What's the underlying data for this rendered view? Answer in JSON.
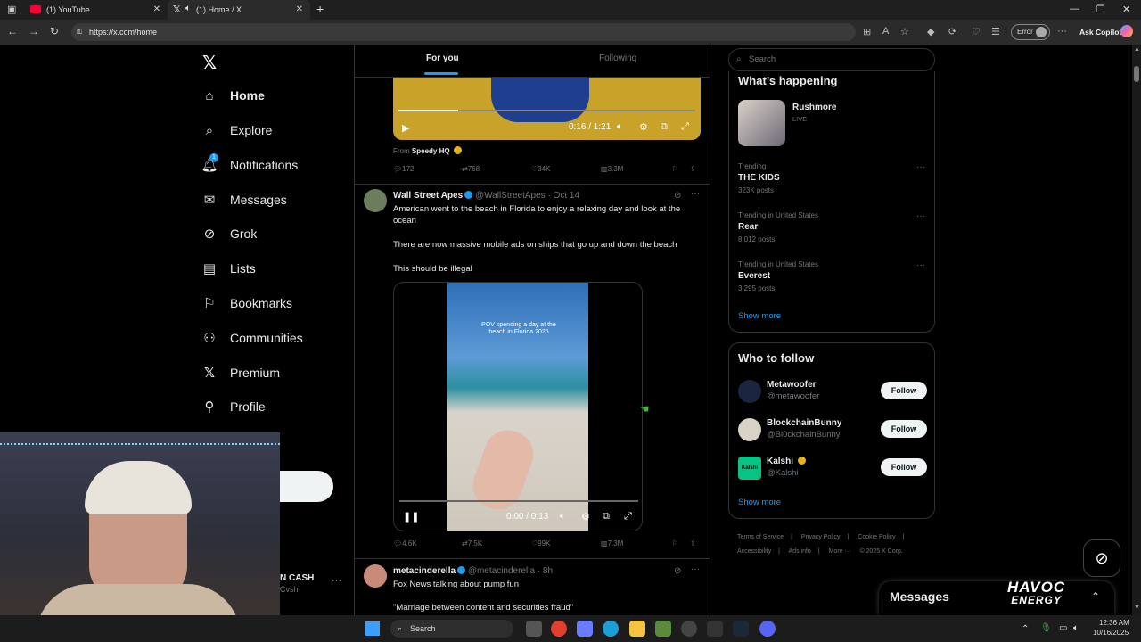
{
  "browser": {
    "tabs": [
      {
        "title": "(1) YouTube"
      },
      {
        "title": "(1) Home / X"
      }
    ],
    "url": "https://x.com/home",
    "error_label": "Error",
    "copilot_label": "Ask Copilot"
  },
  "nav": {
    "items": [
      {
        "label": "Home",
        "icon": "home-icon"
      },
      {
        "label": "Explore",
        "icon": "search-icon"
      },
      {
        "label": "Notifications",
        "icon": "bell-icon",
        "badge": "1"
      },
      {
        "label": "Messages",
        "icon": "envelope-icon"
      },
      {
        "label": "Grok",
        "icon": "grok-icon"
      },
      {
        "label": "Lists",
        "icon": "list-icon"
      },
      {
        "label": "Bookmarks",
        "icon": "bookmark-icon"
      },
      {
        "label": "Communities",
        "icon": "people-icon"
      },
      {
        "label": "Premium",
        "icon": "x-icon"
      },
      {
        "label": "Profile",
        "icon": "person-icon"
      }
    ],
    "account_name_partial": "N CASH",
    "account_handle_partial": "Cvsh"
  },
  "feed": {
    "tabs": [
      {
        "label": "For you"
      },
      {
        "label": "Following"
      }
    ],
    "tweet0": {
      "video_time": "0:16 / 1:21",
      "from_label": "From",
      "from_source": "Speedy HQ",
      "stats": {
        "replies": "172",
        "reposts": "768",
        "likes": "34K",
        "views": "3.3M"
      }
    },
    "tweet1": {
      "author": "Wall Street Apes",
      "handle": "@WallStreetApes",
      "date": "· Oct 14",
      "text1": "American went to the beach in Florida to enjoy a relaxing day and look at the ocean",
      "text2": "There are now massive mobile ads on ships that go up and down the beach",
      "text3": "This should be illegal",
      "video_caption": "POV spending a day at the beach in Florida 2025",
      "video_time": "0:00 / 0:13",
      "stats": {
        "replies": "4.6K",
        "reposts": "7.5K",
        "likes": "99K",
        "views": "7.3M"
      }
    },
    "tweet2": {
      "author": "metacinderella",
      "handle": "@metacinderella",
      "date": "· 8h",
      "text1": "Fox News talking about pump fun",
      "text2": "\"Marriage between content and securities fraud\""
    }
  },
  "sidebar": {
    "search_placeholder": "Search",
    "happening": {
      "title": "What’s happening",
      "event": {
        "name": "Rushmore",
        "status": "LIVE"
      },
      "trends": [
        {
          "context": "Trending",
          "name": "THE KIDS",
          "count": "323K posts"
        },
        {
          "context": "Trending in United States",
          "name": "Rear",
          "count": "8,012 posts"
        },
        {
          "context": "Trending in United States",
          "name": "Everest",
          "count": "3,295 posts"
        }
      ],
      "show_more": "Show more"
    },
    "who_to_follow": {
      "title": "Who to follow",
      "accounts": [
        {
          "name": "Metawoofer",
          "handle": "@metawoofer",
          "button": "Follow"
        },
        {
          "name": "BlockchainBunny",
          "handle": "@Bl0ckchainBunny",
          "button": "Follow"
        },
        {
          "name": "Kalshi",
          "handle": "@Kalshi",
          "button": "Follow",
          "avatar_text": "Kalshi"
        }
      ],
      "show_more": "Show more"
    },
    "footer": [
      "Terms of Service",
      "|",
      "Privacy Policy",
      "|",
      "Cookie Policy",
      "|",
      "Accessibility",
      "|",
      "Ads info",
      "|",
      "More ···",
      "© 2025 X Corp."
    ]
  },
  "messages_drawer": {
    "title": "Messages"
  },
  "overlay": {
    "havoc": "HAVOC",
    "energy": "ENERGY"
  },
  "taskbar": {
    "search": "Search",
    "time": "12:36 AM",
    "date": "10/16/2025"
  },
  "colors": {
    "accent": "#1d9bf0",
    "bg": "#000000",
    "border": "#2f3336",
    "muted": "#71767b"
  }
}
